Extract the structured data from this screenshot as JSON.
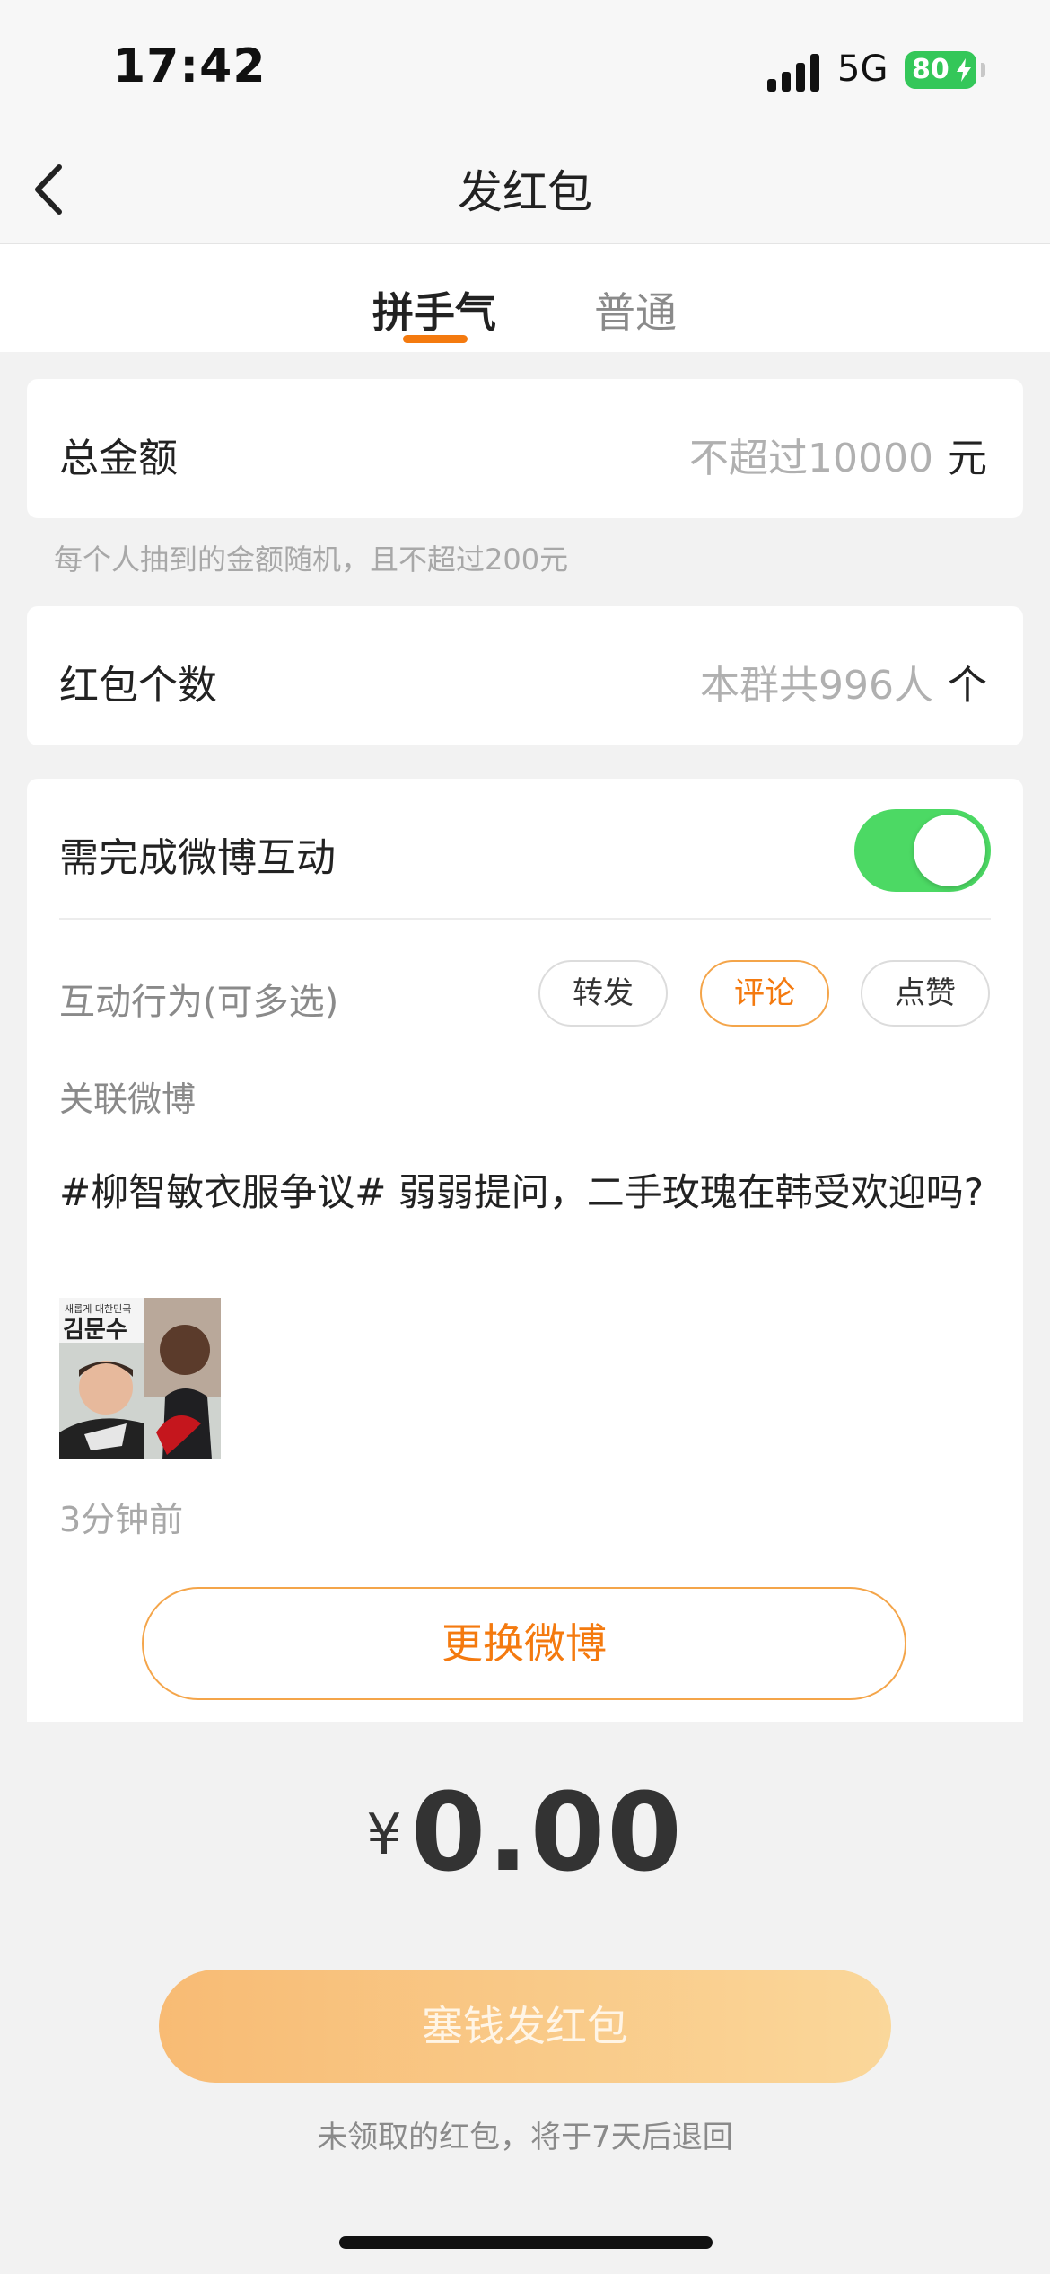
{
  "status_bar": {
    "time": "17:42",
    "network": "5G",
    "battery": "80"
  },
  "header": {
    "title": "发红包"
  },
  "tabs": [
    {
      "label": "拼手气",
      "active": true
    },
    {
      "label": "普通",
      "active": false
    }
  ],
  "amount_row": {
    "label": "总金额",
    "placeholder": "不超过10000",
    "unit": "元"
  },
  "amount_hint": "每个人抽到的金额随机，且不超过200元",
  "count_row": {
    "label": "红包个数",
    "placeholder": "本群共996人",
    "unit": "个"
  },
  "interaction": {
    "label": "需完成微博互动",
    "toggle_on": true,
    "actions_label": "互动行为(可多选)",
    "actions": [
      {
        "label": "转发",
        "selected": false
      },
      {
        "label": "评论",
        "selected": true
      },
      {
        "label": "点赞",
        "selected": false
      }
    ],
    "linked_label": "关联微博",
    "post": {
      "text": "#柳智敏衣服争议# 弱弱提问，二手玫瑰在韩受欢迎吗?",
      "thumb_caption_small": "새롭게 대한민국",
      "thumb_caption_large": "김문수",
      "time_ago": "3分钟前"
    },
    "swap_button": "更换微博"
  },
  "total": {
    "currency": "¥",
    "value": "0.00"
  },
  "send_button": "塞钱发红包",
  "refund_note": "未领取的红包，将于7天后退回",
  "colors": {
    "accent": "#f47a0f",
    "toggle": "#4cd964",
    "background": "#f2f2f2"
  }
}
